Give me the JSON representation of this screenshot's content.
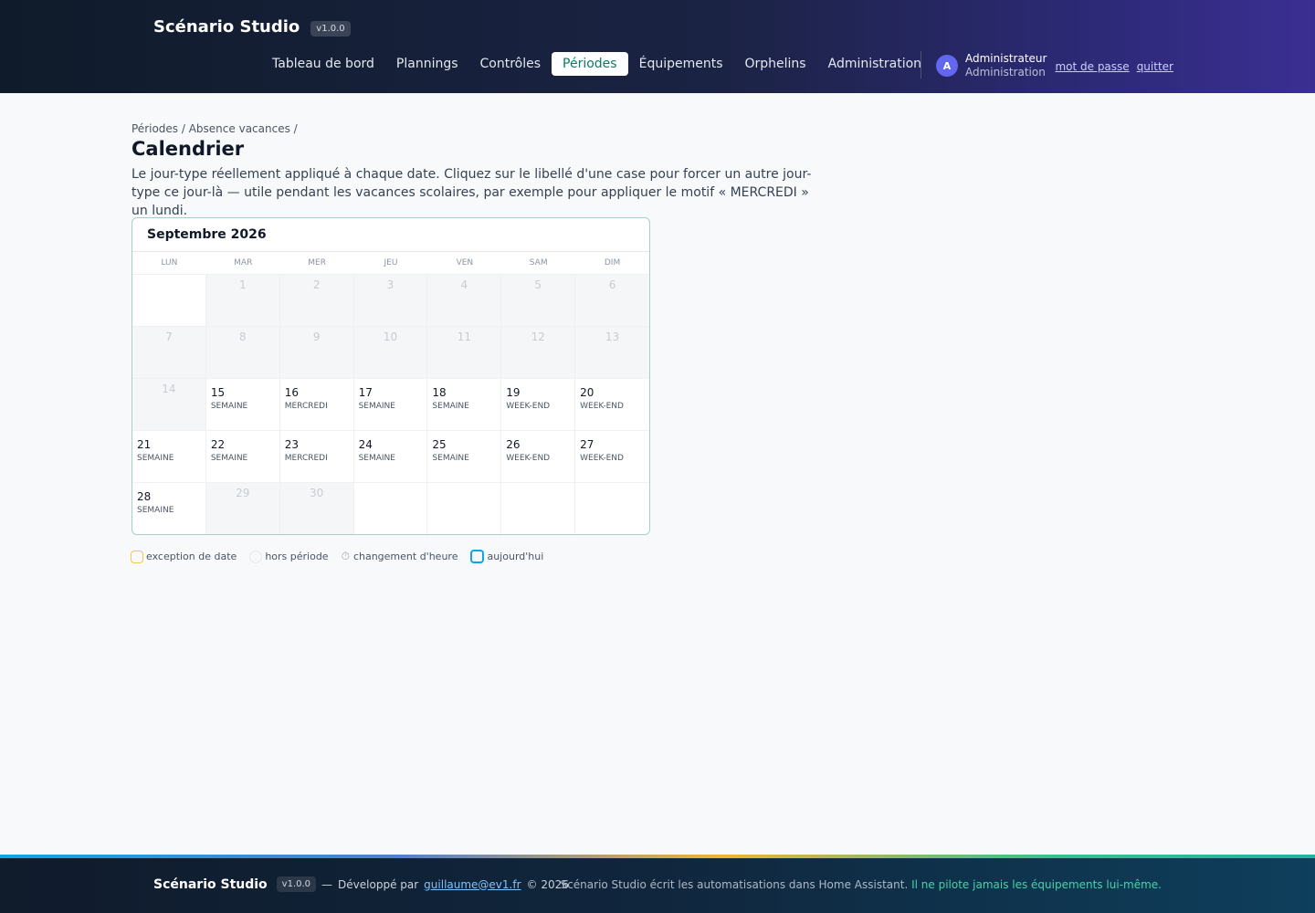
{
  "header": {
    "brand": "Scénario Studio",
    "version": "v1.0.0",
    "nav": [
      {
        "label": "Tableau de bord",
        "active": false
      },
      {
        "label": "Plannings",
        "active": false
      },
      {
        "label": "Contrôles",
        "active": false
      },
      {
        "label": "Périodes",
        "active": true
      },
      {
        "label": "Équipements",
        "active": false
      },
      {
        "label": "Orphelins",
        "active": false
      },
      {
        "label": "Administration",
        "active": false
      }
    ],
    "user": {
      "initial": "A",
      "name": "Administrateur",
      "role": "Administration",
      "password_link": "mot de passe",
      "logout_link": "quitter"
    }
  },
  "main": {
    "breadcrumb": "Périodes / Absence vacances /",
    "title": "Calendrier",
    "description": "Le jour-type réellement appliqué à chaque date. Cliquez sur le libellé d'une case pour forcer un autre jour-type ce jour-là — utile pendant les vacances scolaires, par exemple pour appliquer le motif « MERCREDI » un lundi."
  },
  "calendar": {
    "month": "Septembre 2026",
    "weekdays": [
      "LUN",
      "MAR",
      "MER",
      "JEU",
      "VEN",
      "SAM",
      "DIM"
    ],
    "cells": [
      {
        "day": "",
        "type": "",
        "state": "empty"
      },
      {
        "day": "1",
        "type": "",
        "state": "out"
      },
      {
        "day": "2",
        "type": "",
        "state": "out"
      },
      {
        "day": "3",
        "type": "",
        "state": "out"
      },
      {
        "day": "4",
        "type": "",
        "state": "out"
      },
      {
        "day": "5",
        "type": "",
        "state": "out"
      },
      {
        "day": "6",
        "type": "",
        "state": "out"
      },
      {
        "day": "7",
        "type": "",
        "state": "out"
      },
      {
        "day": "8",
        "type": "",
        "state": "out"
      },
      {
        "day": "9",
        "type": "",
        "state": "out"
      },
      {
        "day": "10",
        "type": "",
        "state": "out"
      },
      {
        "day": "11",
        "type": "",
        "state": "out"
      },
      {
        "day": "12",
        "type": "",
        "state": "out"
      },
      {
        "day": "13",
        "type": "",
        "state": "out"
      },
      {
        "day": "14",
        "type": "",
        "state": "out"
      },
      {
        "day": "15",
        "type": "SEMAINE",
        "state": "in"
      },
      {
        "day": "16",
        "type": "MERCREDI",
        "state": "in"
      },
      {
        "day": "17",
        "type": "SEMAINE",
        "state": "in"
      },
      {
        "day": "18",
        "type": "SEMAINE",
        "state": "in"
      },
      {
        "day": "19",
        "type": "WEEK-END",
        "state": "in"
      },
      {
        "day": "20",
        "type": "WEEK-END",
        "state": "in"
      },
      {
        "day": "21",
        "type": "SEMAINE",
        "state": "in"
      },
      {
        "day": "22",
        "type": "SEMAINE",
        "state": "in"
      },
      {
        "day": "23",
        "type": "MERCREDI",
        "state": "in"
      },
      {
        "day": "24",
        "type": "SEMAINE",
        "state": "in"
      },
      {
        "day": "25",
        "type": "SEMAINE",
        "state": "in"
      },
      {
        "day": "26",
        "type": "WEEK-END",
        "state": "in"
      },
      {
        "day": "27",
        "type": "WEEK-END",
        "state": "in"
      },
      {
        "day": "28",
        "type": "SEMAINE",
        "state": "in"
      },
      {
        "day": "29",
        "type": "",
        "state": "out"
      },
      {
        "day": "30",
        "type": "",
        "state": "out"
      },
      {
        "day": "",
        "type": "",
        "state": "empty"
      },
      {
        "day": "",
        "type": "",
        "state": "empty"
      },
      {
        "day": "",
        "type": "",
        "state": "empty"
      },
      {
        "day": "",
        "type": "",
        "state": "empty"
      }
    ]
  },
  "legend": {
    "exception": "exception de date",
    "out_of_period": "hors période",
    "dst_change": "changement d'heure",
    "today": "aujourd'hui"
  },
  "footer": {
    "brand": "Scénario Studio",
    "version": "v1.0.0",
    "dash": "—",
    "developed_by": "Développé par",
    "email": "guillaume@ev1.fr",
    "copyright": "© 2026",
    "notice": "Scénario Studio écrit les automatisations dans Home Assistant.",
    "notice_accent": "Il ne pilote jamais les équipements lui-même."
  },
  "colors": {
    "accent": "#0e7a63",
    "avatar": "#6366f1",
    "today_ring": "#0ea5e9",
    "exception_ring": "#f2c94c"
  }
}
